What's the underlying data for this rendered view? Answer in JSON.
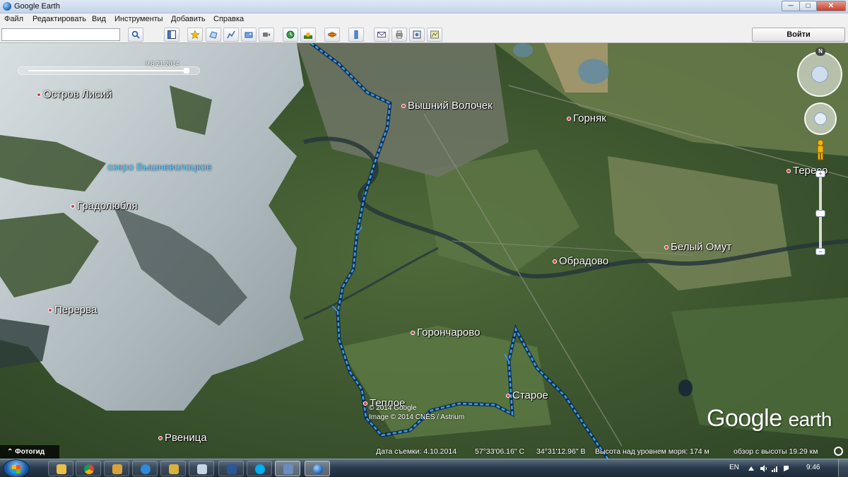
{
  "window": {
    "title": "Google Earth",
    "minimize": "─",
    "maximize": "□",
    "close": "✕"
  },
  "menu": [
    "Файл",
    "Редактировать",
    "Вид",
    "Инструменты",
    "Добавить",
    "Справка"
  ],
  "toolbar": {
    "search_value": "",
    "login_label": "Войти",
    "icons": [
      "search-icon",
      "sidebar-toggle-icon",
      "add-placemark-icon",
      "add-polygon-icon",
      "add-path-icon",
      "add-image-overlay-icon",
      "record-tour-icon",
      "historical-imagery-icon",
      "sunlight-icon",
      "switch-planet-icon",
      "ruler-icon",
      "email-icon",
      "print-icon",
      "save-image-icon",
      "view-in-maps-icon"
    ]
  },
  "map": {
    "time_slider_label": "9.8.21.2014",
    "lake_label": "озеро Вышневолоцкое",
    "places": [
      "Остров Лисий",
      "Вышний Волочек",
      "Горняк",
      "Тересо",
      "Градолюбля",
      "Белый Омут",
      "Обрадово",
      "Перерва",
      "Горончарово",
      "Старое",
      "Теплое",
      "Рвеница"
    ],
    "copyright_lines": [
      "© 2014 Google",
      "Image © 2014 CNES / Astrium"
    ],
    "logo_google": "Google",
    "logo_earth": "earth",
    "photo_tour_label": "Фотогид",
    "north_label": "N",
    "zoom_in": "+",
    "zoom_out": "−"
  },
  "status": {
    "imagery_date": "Дата съемки: 4.10.2014",
    "latitude": "57°33'06.16\" С",
    "longitude": "34°31'12.96\" В",
    "elevation": "Высота над уровнем моря:   174 м",
    "eye_altitude": "обзор с высоты  19.29 км"
  },
  "taskbar": {
    "apps": [
      "explorer-icon",
      "chrome-icon",
      "folder-icon",
      "ie-icon",
      "winamp-icon",
      "notepad-icon",
      "word-icon",
      "skype-icon",
      "remote-desktop-icon",
      "google-earth-icon"
    ],
    "active_app": "google-earth-icon",
    "language": "EN",
    "clock": "9:46"
  },
  "colors": {
    "track": "#3f9cf0",
    "place_dot": "#d6404e",
    "lake_label": "#55d6ff"
  }
}
